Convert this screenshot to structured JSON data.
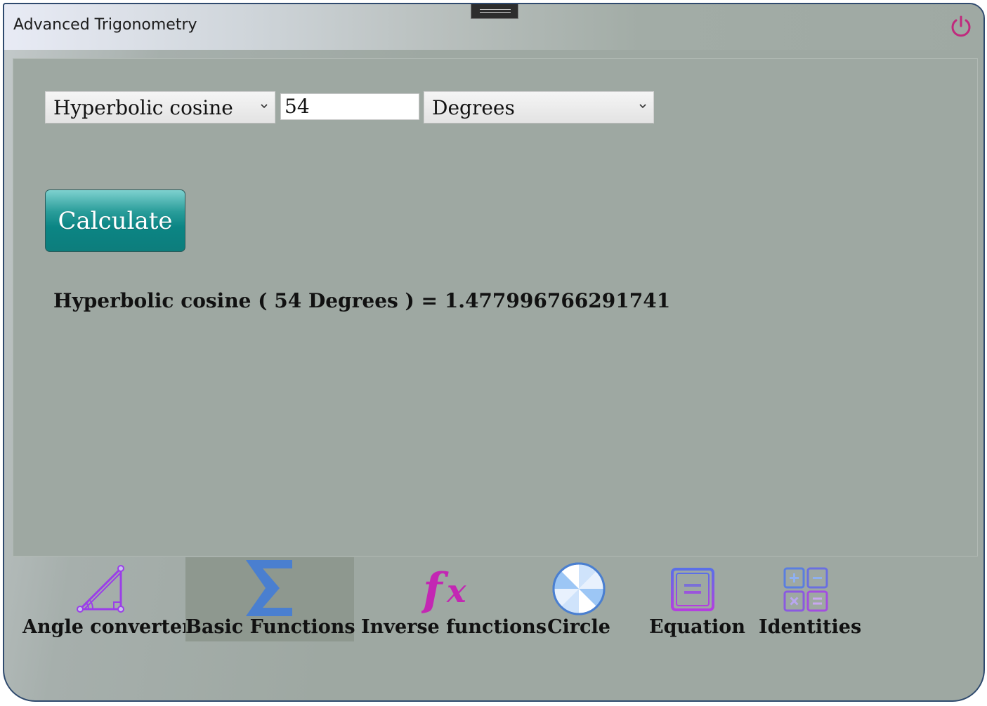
{
  "window": {
    "title": "Advanced Trigonometry"
  },
  "controls": {
    "function_select": "Hyperbolic cosine",
    "angle_value": "54",
    "unit_select": "Degrees",
    "calculate_label": "Calculate"
  },
  "result": {
    "text": "Hyperbolic cosine ( 54 Degrees ) = 1.477996766291741"
  },
  "nav": [
    {
      "label": "Angle converter",
      "icon": "triangle-angle-icon"
    },
    {
      "label": "Basic Functions",
      "icon": "sigma-icon",
      "active": true
    },
    {
      "label": "Inverse functions",
      "icon": "fx-icon"
    },
    {
      "label": "Circle",
      "icon": "circle-icon"
    },
    {
      "label": "Equation",
      "icon": "equals-icon"
    },
    {
      "label": "Identities",
      "icon": "calculator-icon"
    }
  ],
  "colors": {
    "accent_teal": "#0b8584",
    "power_icon": "#c0297d",
    "icon_purple": "#9b3fe8",
    "icon_magenta": "#c327b3",
    "icon_blue": "#4a7fd0"
  }
}
